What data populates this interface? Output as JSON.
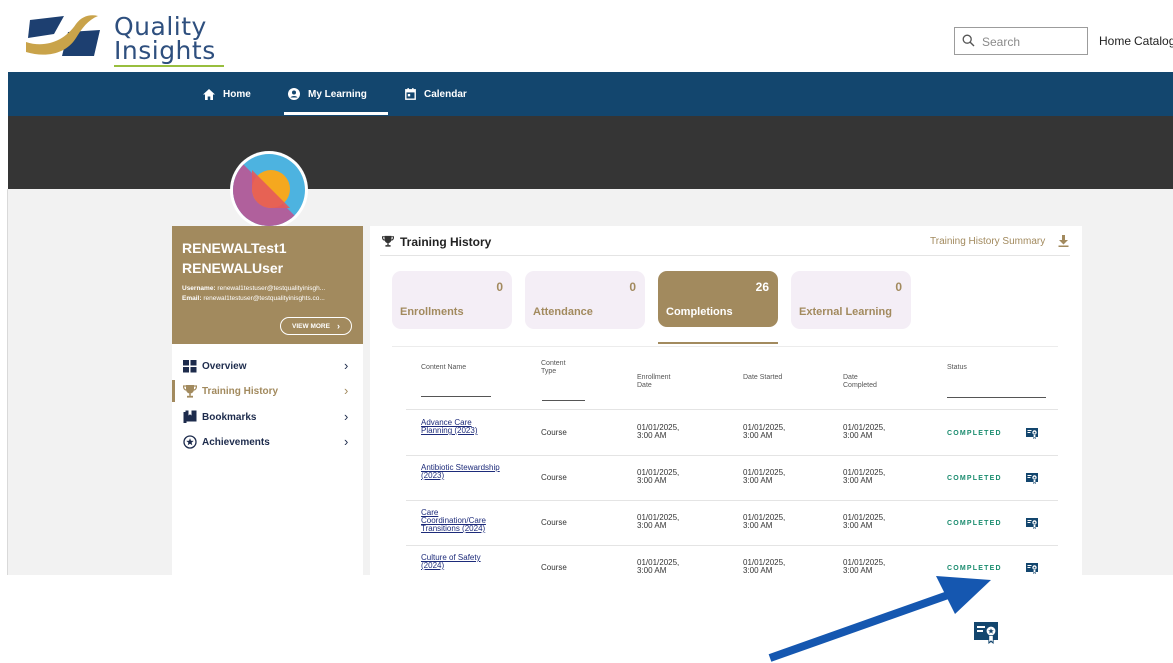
{
  "brand": {
    "line1": "Quality",
    "line2": "Insights",
    "accent": "#13466e",
    "gold": "#a28a5e"
  },
  "header": {
    "search_placeholder": "Search",
    "links": [
      "Home",
      "Catalog"
    ]
  },
  "nav": {
    "items": [
      {
        "label": "Home",
        "icon": "house-icon"
      },
      {
        "label": "My Learning",
        "icon": "user-circle-icon"
      },
      {
        "label": "Calendar",
        "icon": "calendar-icon"
      }
    ],
    "active": "My Learning"
  },
  "profile": {
    "first_name": "RENEWALTest1",
    "last_name": "RENEWALUser",
    "username_label": "Username:",
    "username": "renewal1testuser@testqualityinisgh...",
    "email_label": "Email:",
    "email": "renewal1testuser@testqualityinisghts.co...",
    "view_more": "VIEW MORE"
  },
  "menu": {
    "items": [
      {
        "label": "Overview",
        "icon": "grid-icon"
      },
      {
        "label": "Training History",
        "icon": "trophy-icon"
      },
      {
        "label": "Bookmarks",
        "icon": "book-icon"
      },
      {
        "label": "Achievements",
        "icon": "star-circle-icon"
      }
    ],
    "active": "Training History"
  },
  "training": {
    "title": "Training History",
    "summary_link": "Training History Summary",
    "tiles": [
      {
        "label": "Enrollments",
        "count": "0"
      },
      {
        "label": "Attendance",
        "count": "0"
      },
      {
        "label": "Completions",
        "count": "26"
      },
      {
        "label": "External Learning",
        "count": "0"
      }
    ],
    "active_tile": "Completions",
    "columns": {
      "name": "Content Name",
      "type": "Content Type",
      "enrollment": "Enrollment Date",
      "started": "Date Started",
      "completed": "Date Completed",
      "status": "Status"
    },
    "rows": [
      {
        "name": "Advance Care Planning (2023)",
        "type": "Course",
        "enrollment": "01/01/2025, 3:00 AM",
        "started": "01/01/2025, 3:00 AM",
        "completed": "01/01/2025, 3:00 AM",
        "status": "COMPLETED"
      },
      {
        "name": "Antibiotic Stewardship (2023)",
        "type": "Course",
        "enrollment": "01/01/2025, 3:00 AM",
        "started": "01/01/2025, 3:00 AM",
        "completed": "01/01/2025, 3:00 AM",
        "status": "COMPLETED"
      },
      {
        "name": "Care Coordination/Care Transitions (2024)",
        "type": "Course",
        "enrollment": "01/01/2025, 3:00 AM",
        "started": "01/01/2025, 3:00 AM",
        "completed": "01/01/2025, 3:00 AM",
        "status": "COMPLETED"
      },
      {
        "name": "Culture of Safety (2024)",
        "type": "Course",
        "enrollment": "01/01/2025, 3:00 AM",
        "started": "01/01/2025, 3:00 AM",
        "completed": "01/01/2025, 3:00 AM",
        "status": "COMPLETED"
      }
    ]
  },
  "annotation": {
    "arrow_color": "#1557b0"
  }
}
